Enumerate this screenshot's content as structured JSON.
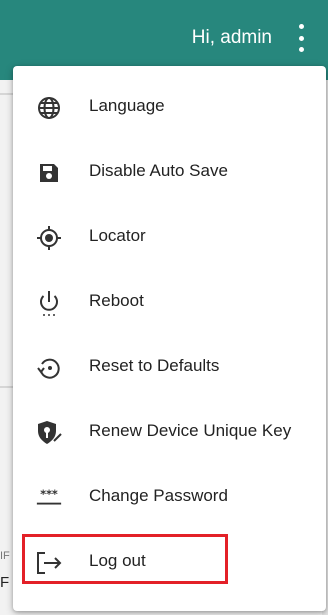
{
  "header": {
    "greeting": "Hi, admin",
    "menu_icon": "more-vert-icon",
    "background_color": "#27877d"
  },
  "background_fragments": {
    "partial_text_1": "IF",
    "partial_text_2": "F"
  },
  "menu": {
    "items": [
      {
        "label": "Language",
        "icon": "globe-icon"
      },
      {
        "label": "Disable Auto Save",
        "icon": "save-icon"
      },
      {
        "label": "Locator",
        "icon": "locator-icon"
      },
      {
        "label": "Reboot",
        "icon": "power-icon"
      },
      {
        "label": "Reset to Defaults",
        "icon": "restore-icon"
      },
      {
        "label": "Renew Device Unique Key",
        "icon": "security-key-icon"
      },
      {
        "label": "Change Password",
        "icon": "password-icon"
      },
      {
        "label": "Log out",
        "icon": "logout-icon"
      }
    ],
    "highlighted_item": "Log out",
    "highlight_color": "#e32028"
  }
}
